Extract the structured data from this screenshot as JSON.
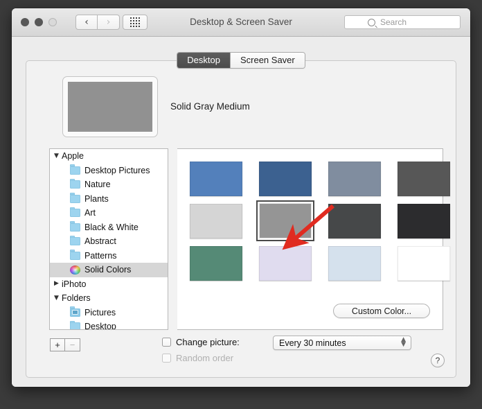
{
  "window": {
    "title": "Desktop & Screen Saver",
    "traffic_lights": [
      "close",
      "minimize",
      "zoom"
    ],
    "nav": {
      "back": "‹",
      "forward": "›",
      "grid": "grid-view"
    }
  },
  "search": {
    "value": "",
    "placeholder": "Search"
  },
  "tabs": [
    {
      "label": "Desktop",
      "active": true
    },
    {
      "label": "Screen Saver",
      "active": false
    }
  ],
  "preview": {
    "name": "Solid Gray Medium",
    "color": "#919191"
  },
  "sidebar": {
    "items": [
      {
        "label": "Apple",
        "type": "group",
        "disclosure": "▼",
        "indent": 0,
        "selected": false
      },
      {
        "label": "Desktop Pictures",
        "type": "folder",
        "disclosure": "",
        "indent": 1,
        "selected": false
      },
      {
        "label": "Nature",
        "type": "folder",
        "disclosure": "",
        "indent": 1,
        "selected": false
      },
      {
        "label": "Plants",
        "type": "folder",
        "disclosure": "",
        "indent": 1,
        "selected": false
      },
      {
        "label": "Art",
        "type": "folder",
        "disclosure": "",
        "indent": 1,
        "selected": false
      },
      {
        "label": "Black & White",
        "type": "folder",
        "disclosure": "",
        "indent": 1,
        "selected": false
      },
      {
        "label": "Abstract",
        "type": "folder",
        "disclosure": "",
        "indent": 1,
        "selected": false
      },
      {
        "label": "Patterns",
        "type": "folder",
        "disclosure": "",
        "indent": 1,
        "selected": false
      },
      {
        "label": "Solid Colors",
        "type": "wheel",
        "disclosure": "",
        "indent": 1,
        "selected": true
      },
      {
        "label": "iPhoto",
        "type": "group",
        "disclosure": "▶",
        "indent": 0,
        "selected": false
      },
      {
        "label": "Folders",
        "type": "group",
        "disclosure": "▼",
        "indent": 0,
        "selected": false
      },
      {
        "label": "Pictures",
        "type": "pictures",
        "disclosure": "",
        "indent": 1,
        "selected": false
      },
      {
        "label": "Desktop",
        "type": "folder",
        "disclosure": "",
        "indent": 1,
        "selected": false
      }
    ]
  },
  "swatches": [
    {
      "name": "Solid Aqua Blue",
      "color": "#5380bb",
      "selected": false
    },
    {
      "name": "Solid Dark Blue",
      "color": "#3c6190",
      "selected": false
    },
    {
      "name": "Solid Gray Blue",
      "color": "#808d9f",
      "selected": false
    },
    {
      "name": "Solid Gray Dark",
      "color": "#575757",
      "selected": false
    },
    {
      "name": "Solid Gray Light",
      "color": "#d5d5d5",
      "selected": false
    },
    {
      "name": "Solid Gray Medium",
      "color": "#959595",
      "selected": true
    },
    {
      "name": "Solid Gray Charcoal",
      "color": "#464849",
      "selected": false
    },
    {
      "name": "Solid Black",
      "color": "#2c2c2e",
      "selected": false
    },
    {
      "name": "Solid Green",
      "color": "#558a76",
      "selected": false
    },
    {
      "name": "Solid Lavender",
      "color": "#e0dcef",
      "selected": false
    },
    {
      "name": "Solid Pale Blue",
      "color": "#d5e1ed",
      "selected": false
    },
    {
      "name": "Solid White",
      "color": "#ffffff",
      "selected": false
    }
  ],
  "buttons": {
    "custom_color": "Custom Color...",
    "add": "+",
    "remove": "−",
    "help": "?"
  },
  "options": {
    "change_picture_label": "Change picture:",
    "change_picture_checked": false,
    "random_order_label": "Random order",
    "random_order_checked": false,
    "random_order_disabled": true,
    "interval_value": "Every 30 minutes"
  },
  "annotation": {
    "type": "red-arrow",
    "color": "#e02b20",
    "points_to": "Solid Gray Medium"
  }
}
